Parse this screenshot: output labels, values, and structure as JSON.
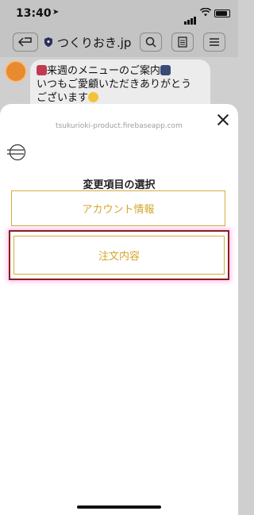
{
  "status": {
    "time": "13:40",
    "location_icon": "location-arrow-icon"
  },
  "header": {
    "title": "つくりおき.jp"
  },
  "chat": {
    "line1": "来週のメニューのご案内",
    "line2": "いつもご愛顧いただきありがとう",
    "line3": "ございます"
  },
  "sheet": {
    "url": "tsukurioki-product.firebaseapp.com",
    "section_title": "変更項目の選択",
    "account_button": "アカウント情報",
    "order_button": "注文内容"
  },
  "colors": {
    "accent": "#d3a62c",
    "highlight_border": "#8b1e1e",
    "avatar": "#e98a2e"
  }
}
